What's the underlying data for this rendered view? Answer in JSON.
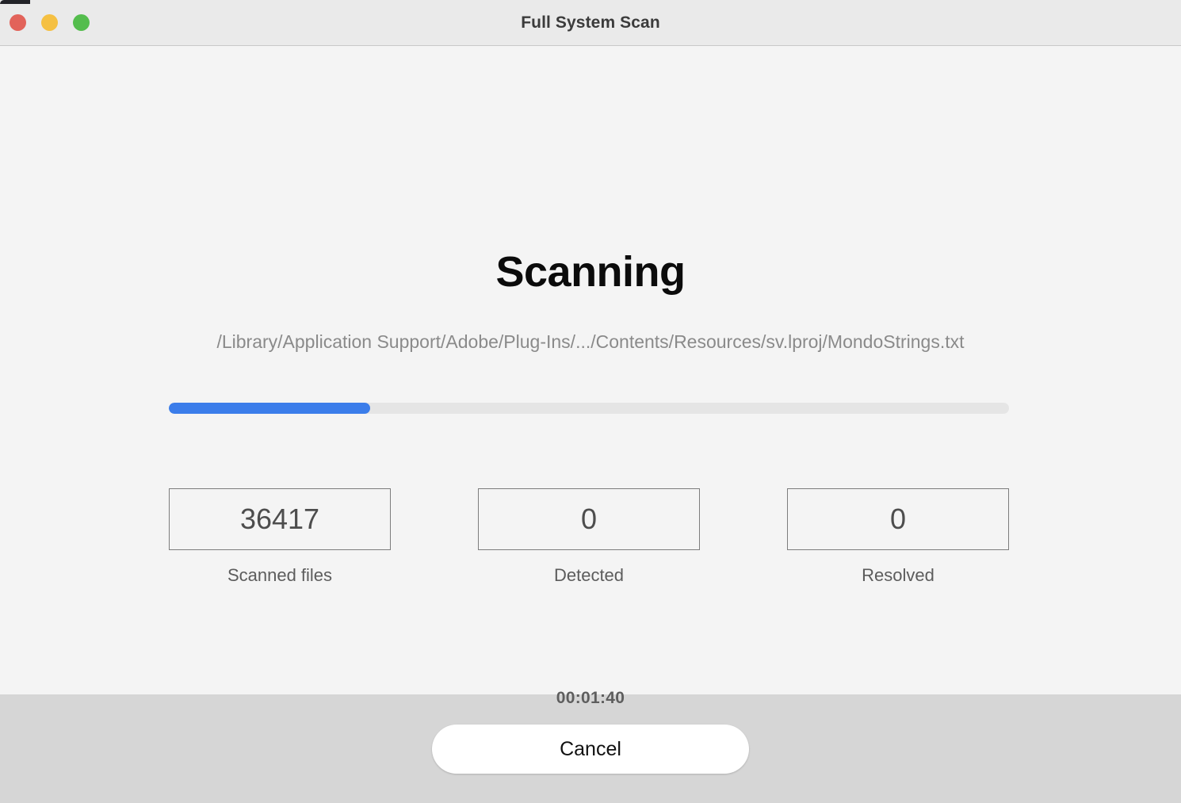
{
  "window": {
    "title": "Full System Scan",
    "traffic_lights": [
      {
        "name": "close",
        "color": "#e2635a"
      },
      {
        "name": "minimize",
        "color": "#f5c042"
      },
      {
        "name": "zoom",
        "color": "#54bd4d"
      }
    ]
  },
  "scan": {
    "status_heading": "Scanning",
    "current_path": "/Library/Application Support/Adobe/Plug-Ins/.../Contents/Resources/sv.lproj/MondoStrings.txt",
    "progress_percent": 24,
    "progress_fill_color": "#3b7dea",
    "progress_track_color": "#e5e5e5",
    "elapsed_time": "00:01:40",
    "stats": [
      {
        "name": "scanned-files",
        "value": "36417",
        "label": "Scanned files"
      },
      {
        "name": "detected",
        "value": "0",
        "label": "Detected"
      },
      {
        "name": "resolved",
        "value": "0",
        "label": "Resolved"
      }
    ]
  },
  "footer": {
    "cancel_label": "Cancel"
  }
}
